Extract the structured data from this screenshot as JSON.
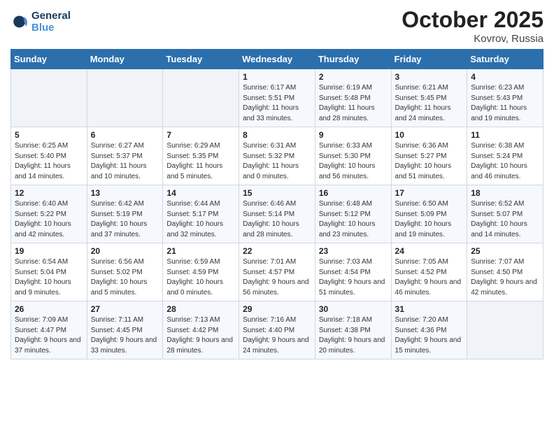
{
  "header": {
    "logo_line1": "General",
    "logo_line2": "Blue",
    "title": "October 2025",
    "location": "Kovrov, Russia"
  },
  "weekdays": [
    "Sunday",
    "Monday",
    "Tuesday",
    "Wednesday",
    "Thursday",
    "Friday",
    "Saturday"
  ],
  "weeks": [
    [
      {
        "day": "",
        "sunrise": "",
        "sunset": "",
        "daylight": "",
        "empty": true
      },
      {
        "day": "",
        "sunrise": "",
        "sunset": "",
        "daylight": "",
        "empty": true
      },
      {
        "day": "",
        "sunrise": "",
        "sunset": "",
        "daylight": "",
        "empty": true
      },
      {
        "day": "1",
        "sunrise": "Sunrise: 6:17 AM",
        "sunset": "Sunset: 5:51 PM",
        "daylight": "Daylight: 11 hours and 33 minutes."
      },
      {
        "day": "2",
        "sunrise": "Sunrise: 6:19 AM",
        "sunset": "Sunset: 5:48 PM",
        "daylight": "Daylight: 11 hours and 28 minutes."
      },
      {
        "day": "3",
        "sunrise": "Sunrise: 6:21 AM",
        "sunset": "Sunset: 5:45 PM",
        "daylight": "Daylight: 11 hours and 24 minutes."
      },
      {
        "day": "4",
        "sunrise": "Sunrise: 6:23 AM",
        "sunset": "Sunset: 5:43 PM",
        "daylight": "Daylight: 11 hours and 19 minutes."
      }
    ],
    [
      {
        "day": "5",
        "sunrise": "Sunrise: 6:25 AM",
        "sunset": "Sunset: 5:40 PM",
        "daylight": "Daylight: 11 hours and 14 minutes."
      },
      {
        "day": "6",
        "sunrise": "Sunrise: 6:27 AM",
        "sunset": "Sunset: 5:37 PM",
        "daylight": "Daylight: 11 hours and 10 minutes."
      },
      {
        "day": "7",
        "sunrise": "Sunrise: 6:29 AM",
        "sunset": "Sunset: 5:35 PM",
        "daylight": "Daylight: 11 hours and 5 minutes."
      },
      {
        "day": "8",
        "sunrise": "Sunrise: 6:31 AM",
        "sunset": "Sunset: 5:32 PM",
        "daylight": "Daylight: 11 hours and 0 minutes."
      },
      {
        "day": "9",
        "sunrise": "Sunrise: 6:33 AM",
        "sunset": "Sunset: 5:30 PM",
        "daylight": "Daylight: 10 hours and 56 minutes."
      },
      {
        "day": "10",
        "sunrise": "Sunrise: 6:36 AM",
        "sunset": "Sunset: 5:27 PM",
        "daylight": "Daylight: 10 hours and 51 minutes."
      },
      {
        "day": "11",
        "sunrise": "Sunrise: 6:38 AM",
        "sunset": "Sunset: 5:24 PM",
        "daylight": "Daylight: 10 hours and 46 minutes."
      }
    ],
    [
      {
        "day": "12",
        "sunrise": "Sunrise: 6:40 AM",
        "sunset": "Sunset: 5:22 PM",
        "daylight": "Daylight: 10 hours and 42 minutes."
      },
      {
        "day": "13",
        "sunrise": "Sunrise: 6:42 AM",
        "sunset": "Sunset: 5:19 PM",
        "daylight": "Daylight: 10 hours and 37 minutes."
      },
      {
        "day": "14",
        "sunrise": "Sunrise: 6:44 AM",
        "sunset": "Sunset: 5:17 PM",
        "daylight": "Daylight: 10 hours and 32 minutes."
      },
      {
        "day": "15",
        "sunrise": "Sunrise: 6:46 AM",
        "sunset": "Sunset: 5:14 PM",
        "daylight": "Daylight: 10 hours and 28 minutes."
      },
      {
        "day": "16",
        "sunrise": "Sunrise: 6:48 AM",
        "sunset": "Sunset: 5:12 PM",
        "daylight": "Daylight: 10 hours and 23 minutes."
      },
      {
        "day": "17",
        "sunrise": "Sunrise: 6:50 AM",
        "sunset": "Sunset: 5:09 PM",
        "daylight": "Daylight: 10 hours and 19 minutes."
      },
      {
        "day": "18",
        "sunrise": "Sunrise: 6:52 AM",
        "sunset": "Sunset: 5:07 PM",
        "daylight": "Daylight: 10 hours and 14 minutes."
      }
    ],
    [
      {
        "day": "19",
        "sunrise": "Sunrise: 6:54 AM",
        "sunset": "Sunset: 5:04 PM",
        "daylight": "Daylight: 10 hours and 9 minutes."
      },
      {
        "day": "20",
        "sunrise": "Sunrise: 6:56 AM",
        "sunset": "Sunset: 5:02 PM",
        "daylight": "Daylight: 10 hours and 5 minutes."
      },
      {
        "day": "21",
        "sunrise": "Sunrise: 6:59 AM",
        "sunset": "Sunset: 4:59 PM",
        "daylight": "Daylight: 10 hours and 0 minutes."
      },
      {
        "day": "22",
        "sunrise": "Sunrise: 7:01 AM",
        "sunset": "Sunset: 4:57 PM",
        "daylight": "Daylight: 9 hours and 56 minutes."
      },
      {
        "day": "23",
        "sunrise": "Sunrise: 7:03 AM",
        "sunset": "Sunset: 4:54 PM",
        "daylight": "Daylight: 9 hours and 51 minutes."
      },
      {
        "day": "24",
        "sunrise": "Sunrise: 7:05 AM",
        "sunset": "Sunset: 4:52 PM",
        "daylight": "Daylight: 9 hours and 46 minutes."
      },
      {
        "day": "25",
        "sunrise": "Sunrise: 7:07 AM",
        "sunset": "Sunset: 4:50 PM",
        "daylight": "Daylight: 9 hours and 42 minutes."
      }
    ],
    [
      {
        "day": "26",
        "sunrise": "Sunrise: 7:09 AM",
        "sunset": "Sunset: 4:47 PM",
        "daylight": "Daylight: 9 hours and 37 minutes."
      },
      {
        "day": "27",
        "sunrise": "Sunrise: 7:11 AM",
        "sunset": "Sunset: 4:45 PM",
        "daylight": "Daylight: 9 hours and 33 minutes."
      },
      {
        "day": "28",
        "sunrise": "Sunrise: 7:13 AM",
        "sunset": "Sunset: 4:42 PM",
        "daylight": "Daylight: 9 hours and 28 minutes."
      },
      {
        "day": "29",
        "sunrise": "Sunrise: 7:16 AM",
        "sunset": "Sunset: 4:40 PM",
        "daylight": "Daylight: 9 hours and 24 minutes."
      },
      {
        "day": "30",
        "sunrise": "Sunrise: 7:18 AM",
        "sunset": "Sunset: 4:38 PM",
        "daylight": "Daylight: 9 hours and 20 minutes."
      },
      {
        "day": "31",
        "sunrise": "Sunrise: 7:20 AM",
        "sunset": "Sunset: 4:36 PM",
        "daylight": "Daylight: 9 hours and 15 minutes."
      },
      {
        "day": "",
        "sunrise": "",
        "sunset": "",
        "daylight": "",
        "empty": true
      }
    ]
  ]
}
